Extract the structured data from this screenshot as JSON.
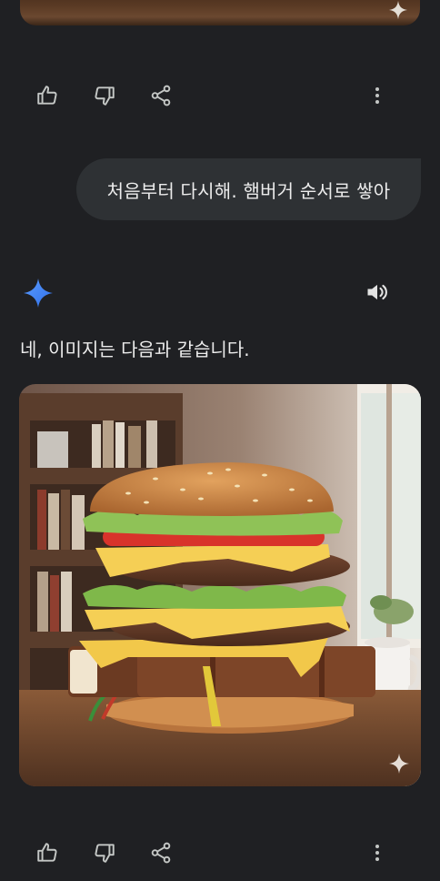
{
  "colors": {
    "background": "#1f2023",
    "bubble": "#2e3134",
    "text": "#ececec",
    "icon": "#c4c7c5",
    "gemini_blue": "#4285f4"
  },
  "previous_image": {
    "icon": "sparkle-icon"
  },
  "action_bar_1": {
    "icons": [
      "thumbs-up-icon",
      "thumbs-down-icon",
      "share-icon",
      "more-vert-icon"
    ]
  },
  "user_message": {
    "text": "처음부터 다시해. 햄버거 순서로 쌓아"
  },
  "assistant": {
    "logo": "gemini-sparkle-icon",
    "speaker": "speaker-icon",
    "response_text": "네, 이미지는 다음과 같습니다.",
    "image": {
      "description_icon": "sparkle-icon",
      "alt": "햄버거"
    }
  },
  "action_bar_2": {
    "icons": [
      "thumbs-up-icon",
      "thumbs-down-icon",
      "share-icon",
      "more-vert-icon"
    ]
  }
}
